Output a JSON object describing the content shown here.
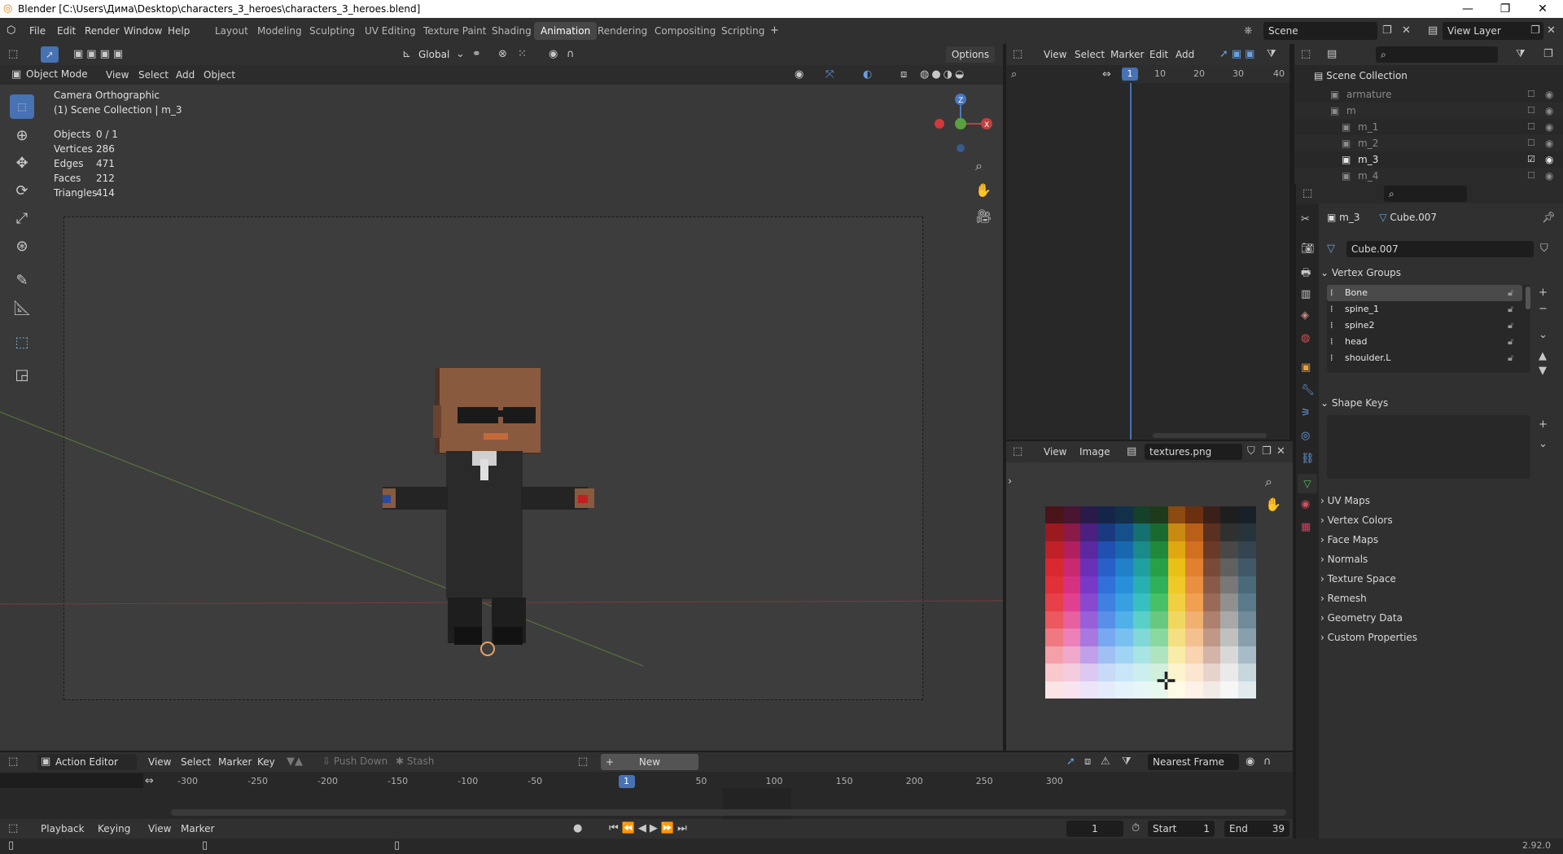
{
  "window": {
    "title": "Blender [C:\\Users\\Дима\\Desktop\\characters_3_heroes\\characters_3_heroes.blend]"
  },
  "menu": [
    "File",
    "Edit",
    "Render",
    "Window",
    "Help"
  ],
  "workspaces": [
    "Layout",
    "Modeling",
    "Sculpting",
    "UV Editing",
    "Texture Paint",
    "Shading",
    "Animation",
    "Rendering",
    "Compositing",
    "Scripting"
  ],
  "active_workspace": "Animation",
  "scene": "Scene",
  "view_layer": "View Layer",
  "viewport": {
    "mode": "Object Mode",
    "menus": [
      "View",
      "Select",
      "Add",
      "Object"
    ],
    "transform": "Global",
    "options": "Options",
    "camera_label": "Camera Orthographic",
    "collection_label": "(1) Scene Collection | m_3",
    "stats": [
      {
        "label": "Objects",
        "value": "0 / 1"
      },
      {
        "label": "Vertices",
        "value": "286"
      },
      {
        "label": "Edges",
        "value": "471"
      },
      {
        "label": "Faces",
        "value": "212"
      },
      {
        "label": "Triangles",
        "value": "414"
      }
    ]
  },
  "dopesheet_top": {
    "menus": [
      "View",
      "Select",
      "Marker",
      "Edit",
      "Add"
    ],
    "current_frame": "1",
    "ticks": [
      "10",
      "20",
      "30",
      "40"
    ]
  },
  "image_editor": {
    "menus": [
      "View",
      "Image"
    ],
    "image_name": "textures.png"
  },
  "palette_colors": [
    [
      "#4a1418",
      "#4a1530",
      "#2a1a4a",
      "#15254a",
      "#12304a",
      "#15402a",
      "#1e3a1a",
      "#8a4a10",
      "#6a3010",
      "#3a2018",
      "#1e1e1e",
      "#1a2028"
    ],
    [
      "#9a1a20",
      "#8a1a48",
      "#4a2080",
      "#1a3a80",
      "#15508a",
      "#157070",
      "#1a6a30",
      "#c88a10",
      "#b8601a",
      "#5a3020",
      "#303030",
      "#28343c"
    ],
    [
      "#c02028",
      "#b02060",
      "#5a28a0",
      "#2050b0",
      "#1868b0",
      "#1a8a8a",
      "#208a3a",
      "#e0a810",
      "#d07020",
      "#6a3a28",
      "#484848",
      "#344450"
    ],
    [
      "#d82830",
      "#c82870",
      "#6a30b8",
      "#2860c8",
      "#2080c8",
      "#20a0a0",
      "#28a048",
      "#e8c018",
      "#e08030",
      "#7a4a38",
      "#606060",
      "#405868"
    ],
    [
      "#e03038",
      "#d83080",
      "#7838c8",
      "#3070d8",
      "#2890d8",
      "#28b0b0",
      "#30b058",
      "#f0c828",
      "#e89040",
      "#8a5a48",
      "#787878",
      "#4a6a7a"
    ],
    [
      "#e84048",
      "#e04090",
      "#8848d0",
      "#4080e0",
      "#38a0e0",
      "#38c0c0",
      "#48c068",
      "#f0d040",
      "#f0a050",
      "#9a6a58",
      "#909090",
      "#5a7a8a"
    ],
    [
      "#ec5860",
      "#e860a0",
      "#9860d8",
      "#5890e8",
      "#50b0e8",
      "#58d0c8",
      "#68c880",
      "#f0d860",
      "#f0b070",
      "#ae8070",
      "#a8a8a8",
      "#708a9a"
    ],
    [
      "#f07880",
      "#ec80b8",
      "#a878e0",
      "#78a8f0",
      "#78c0f0",
      "#80d8d8",
      "#88d8a0",
      "#f4e080",
      "#f4c090",
      "#c09888",
      "#c0c0c0",
      "#88a0ae"
    ],
    [
      "#f4a0a8",
      "#f0a8cc",
      "#c0a0e8",
      "#a0c0f4",
      "#a0d4f4",
      "#a8e4e4",
      "#b0e4c0",
      "#f8eca8",
      "#f8d4b0",
      "#d4b4a8",
      "#d8d8d8",
      "#a8bcc8"
    ],
    [
      "#f8c8cc",
      "#f4ccdf",
      "#dcc8f0",
      "#c8daf8",
      "#c8e6f8",
      "#cceeee",
      "#d0f0dc",
      "#fcf4cc",
      "#fce6d0",
      "#e6d4cc",
      "#eaeaea",
      "#c8d6de"
    ],
    [
      "#fce4e6",
      "#f8e4ee",
      "#ece4f8",
      "#e4ecfc",
      "#e4f2fc",
      "#e6f6f6",
      "#e8f8ee",
      "#fefae6",
      "#fef2e8",
      "#f2eae6",
      "#f6f6f6",
      "#e2eaee"
    ]
  ],
  "outliner": {
    "root": "Scene Collection",
    "items": [
      {
        "name": "armature",
        "indent": 1
      },
      {
        "name": "m",
        "indent": 1
      },
      {
        "name": "m_1",
        "indent": 2
      },
      {
        "name": "m_2",
        "indent": 2
      },
      {
        "name": "m_3",
        "indent": 2
      },
      {
        "name": "m_4",
        "indent": 2
      }
    ]
  },
  "properties": {
    "breadcrumb_object": "m_3",
    "breadcrumb_mesh": "Cube.007",
    "mesh_name": "Cube.007",
    "vertex_groups_title": "Vertex Groups",
    "vertex_groups": [
      "Bone",
      "spine_1",
      "spine2",
      "head",
      "shoulder.L"
    ],
    "shape_keys_title": "Shape Keys",
    "sections": [
      "UV Maps",
      "Vertex Colors",
      "Face Maps",
      "Normals",
      "Texture Space",
      "Remesh",
      "Geometry Data",
      "Custom Properties"
    ]
  },
  "action_editor": {
    "mode": "Action Editor",
    "menus": [
      "View",
      "Select",
      "Marker",
      "Key"
    ],
    "push_down": "Push Down",
    "stash": "Stash",
    "new_label": "New",
    "snap": "Nearest Frame",
    "ticks": [
      "-300",
      "-250",
      "-200",
      "-150",
      "-100",
      "-50",
      "1",
      "50",
      "100",
      "150",
      "200",
      "250",
      "300"
    ]
  },
  "timeline": {
    "menus": [
      "Playback",
      "Keying",
      "View",
      "Marker"
    ],
    "current_frame": "1",
    "start_label": "Start",
    "start": "1",
    "end_label": "End",
    "end": "39"
  },
  "version": "2.92.0"
}
